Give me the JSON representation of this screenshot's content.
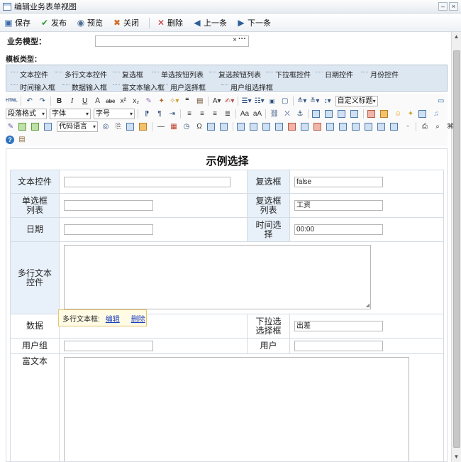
{
  "window": {
    "title": "编辑业务表单视图",
    "min": "–",
    "close": "×"
  },
  "toolbar": {
    "save": "保存",
    "publish": "发布",
    "preview": "预览",
    "close": "关闭",
    "delete": "删除",
    "prev": "上一条",
    "next": "下一条"
  },
  "form": {
    "model_label": "业务模型：",
    "model_clear": "×",
    "model_more": "···",
    "template_label": "模板类型："
  },
  "templates": {
    "row1": [
      "文本控件",
      "多行文本控件",
      "复选框",
      "单选按钮列表",
      "复选按钮列表",
      "下拉框控件",
      "日期控件",
      "月份控件"
    ],
    "row2": [
      "时间输入框",
      "数据输入框",
      "富文本输入框",
      "用户选择框",
      "用户组选择框"
    ]
  },
  "editor": {
    "html": "HTML",
    "bold": "B",
    "italic": "I",
    "underline": "U",
    "custom_title": "自定义标题",
    "paragraph_format": "段落格式",
    "font": "字体",
    "font_size": "字号",
    "code_lang": "代码语言",
    "omega": "Ω"
  },
  "doc": {
    "title": "示例选择",
    "rows": {
      "text_ctrl": "文本控件",
      "checkbox": "复选框",
      "checkbox_value": "false",
      "radio_list": "单选框列表",
      "check_list": "复选框列表",
      "check_list_value": "工资",
      "date": "日期",
      "time_select": "时间选择",
      "time_value": "00:00",
      "multiline": "多行文本控件",
      "data": "数据",
      "dropdown": "下拉选选择框",
      "dropdown_value": "出差",
      "user_group": "用户组",
      "user": "用户",
      "rich_text": "富文本"
    },
    "tip": {
      "text": "多行文本框:",
      "edit": "编辑",
      "delete": "删除"
    }
  }
}
